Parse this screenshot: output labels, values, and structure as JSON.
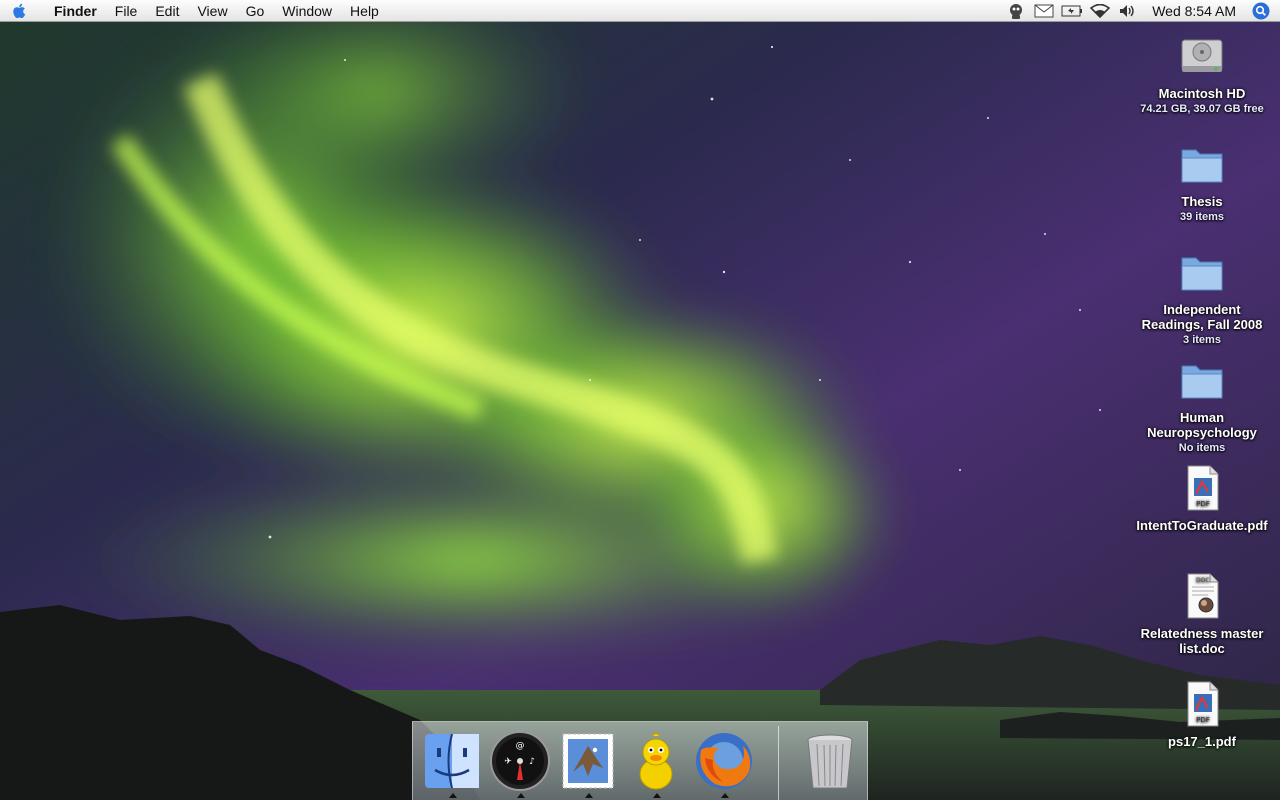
{
  "menubar": {
    "app_name": "Finder",
    "menus": [
      "File",
      "Edit",
      "View",
      "Go",
      "Window",
      "Help"
    ],
    "clock": "Wed 8:54 AM",
    "status_icons": [
      "chat-status-icon",
      "mail-icon",
      "battery-icon",
      "wifi-icon",
      "volume-icon"
    ]
  },
  "desktop": {
    "items": [
      {
        "name": "Macintosh HD",
        "sub": "74.21 GB, 39.07 GB free",
        "icon": "hard-drive-icon"
      },
      {
        "name": "Thesis",
        "sub": "39 items",
        "icon": "folder-icon"
      },
      {
        "name": "Independent Readings, Fall 2008",
        "sub": "3 items",
        "icon": "folder-icon"
      },
      {
        "name": "Human Neuropsychology",
        "sub": "No items",
        "icon": "folder-icon"
      },
      {
        "name": "IntentToGraduate.pdf",
        "sub": "",
        "icon": "pdf-file-icon",
        "badge": "PDF"
      },
      {
        "name": "Relatedness master list.doc",
        "sub": "",
        "icon": "doc-file-icon",
        "badge": "DOC"
      },
      {
        "name": "ps17_1.pdf",
        "sub": "",
        "icon": "pdf-file-icon",
        "badge": "PDF"
      }
    ]
  },
  "dock": {
    "apps": [
      "Finder",
      "Dashboard",
      "Mail",
      "Adium",
      "Firefox"
    ],
    "trash": "Trash",
    "running": [
      "Finder",
      "Dashboard",
      "Mail",
      "Adium",
      "Firefox"
    ]
  },
  "colors": {
    "aurora": "#b6ff3a",
    "sky_top": "#3a2a5c",
    "menubar": "#efefef",
    "folder": "#8fb8e8"
  }
}
